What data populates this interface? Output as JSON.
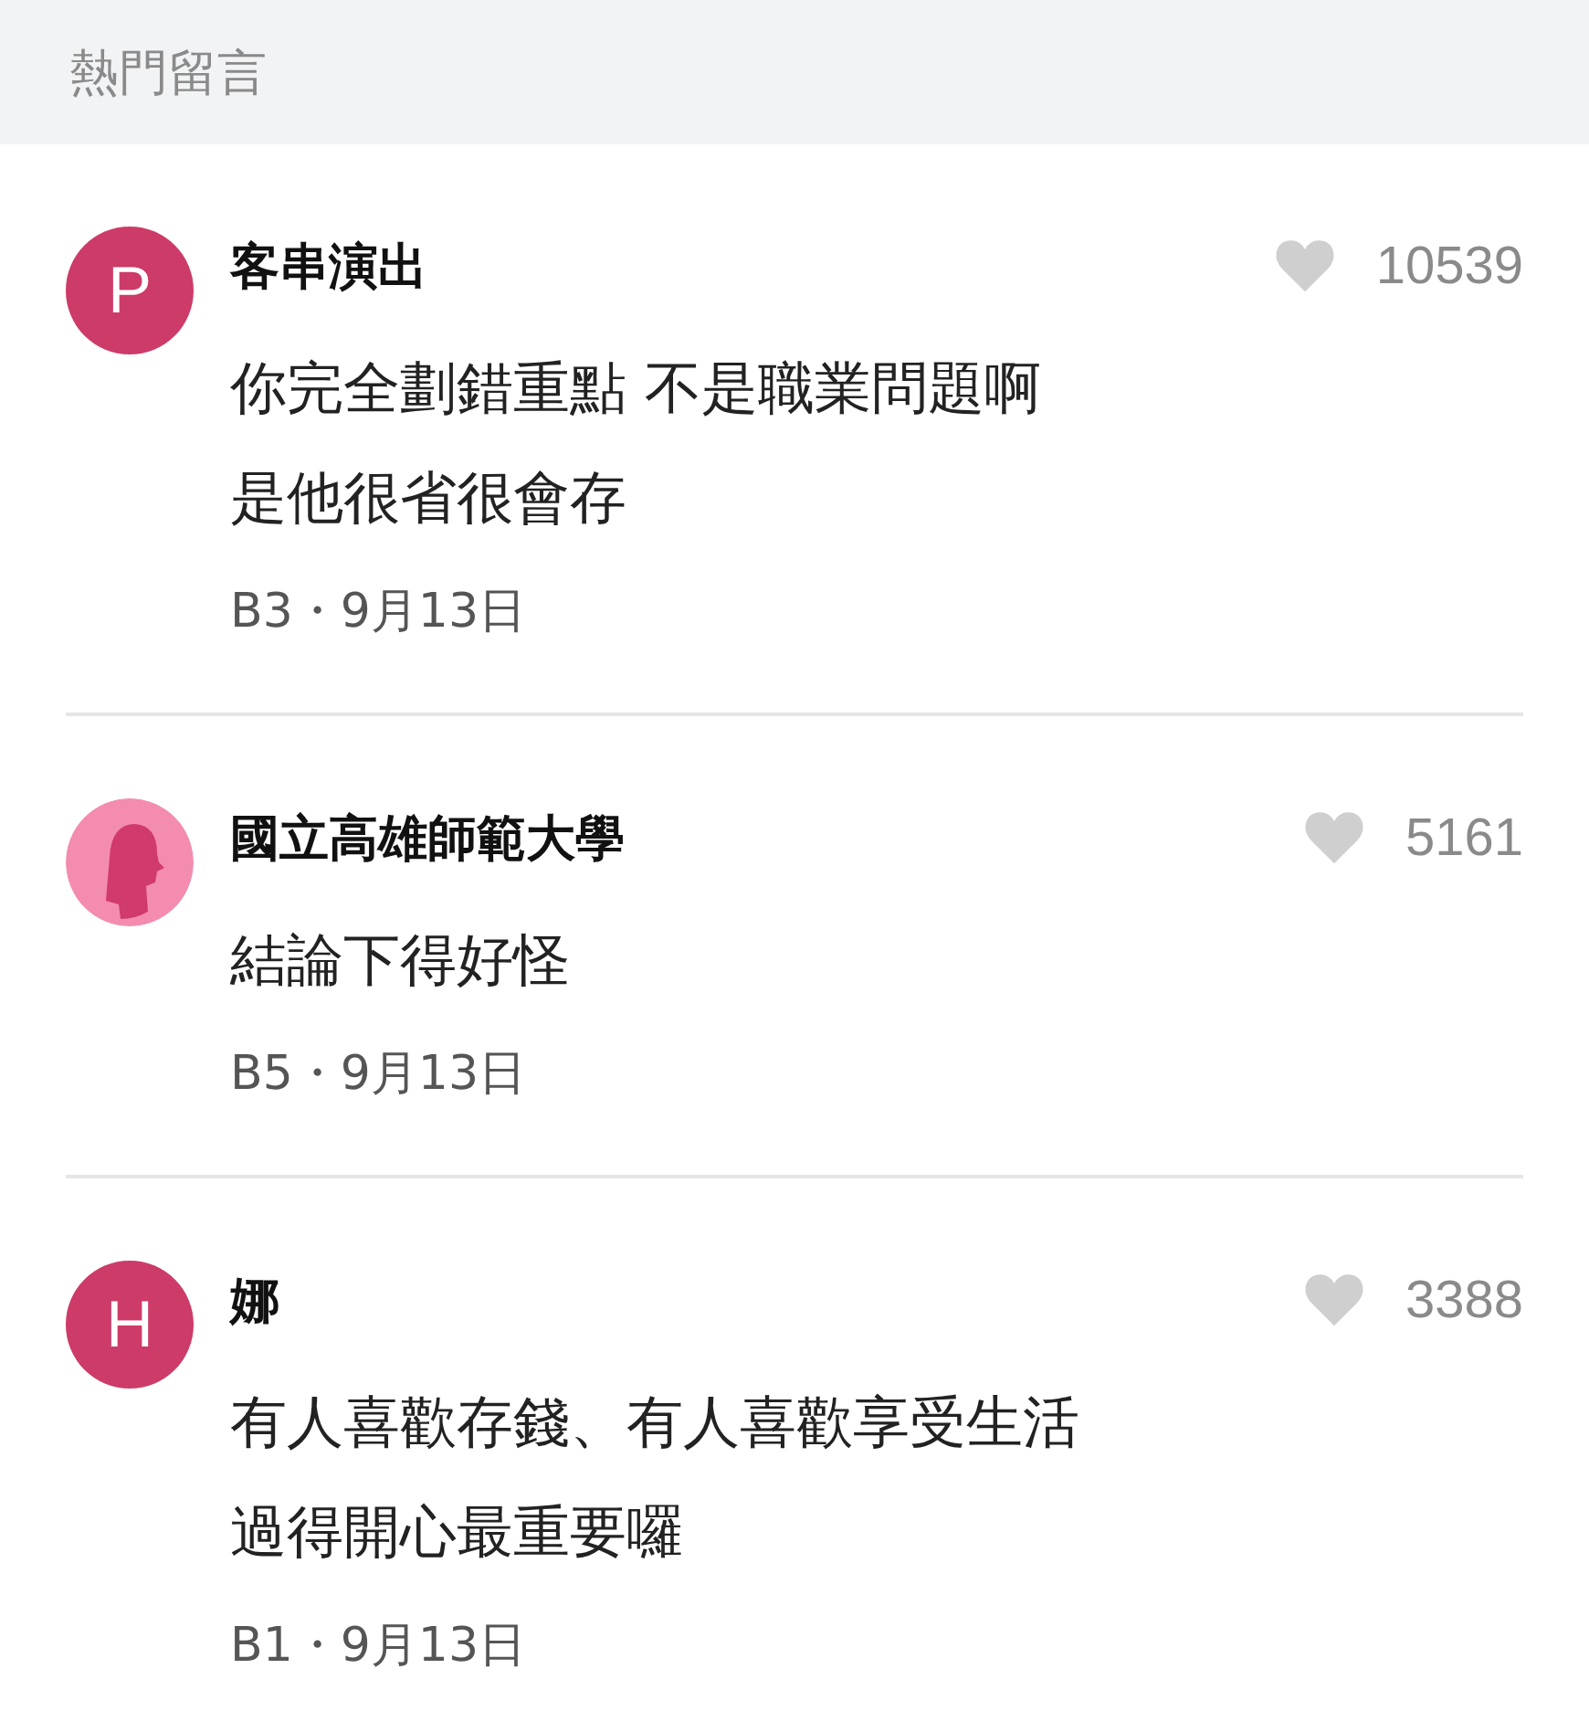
{
  "section_title": "熱門留言",
  "comments": [
    {
      "avatar": {
        "kind": "letter",
        "letter": "P"
      },
      "name": "客串演出",
      "likes": "10539",
      "lines": [
        "你完全劃錯重點 不是職業問題啊",
        "是他很省很會存"
      ],
      "meta": "B3・9月13日"
    },
    {
      "avatar": {
        "kind": "silhouette"
      },
      "name": "國立高雄師範大學",
      "likes": "5161",
      "lines": [
        "結論下得好怪"
      ],
      "meta": "B5・9月13日"
    },
    {
      "avatar": {
        "kind": "letter",
        "letter": "H"
      },
      "name": "娜",
      "likes": "3388",
      "lines": [
        "有人喜歡存錢、有人喜歡享受生活",
        "過得開心最重要囉"
      ],
      "meta": "B1・9月13日"
    }
  ]
}
